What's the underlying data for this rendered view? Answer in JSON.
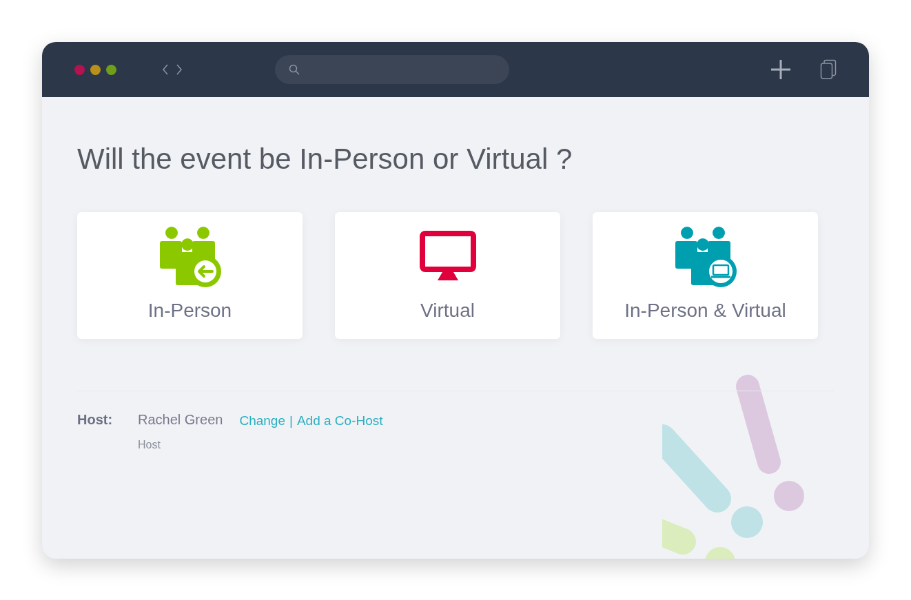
{
  "question": "Will the event be In-Person or Virtual ?",
  "options": [
    {
      "kind": "in-person",
      "label": "In-Person",
      "color": "#8cc800"
    },
    {
      "kind": "virtual",
      "label": "Virtual",
      "color": "#e0003c"
    },
    {
      "kind": "hybrid",
      "label": "In-Person & Virtual",
      "color": "#009fb0"
    }
  ],
  "host": {
    "label": "Host:",
    "name": "Rachel Green",
    "role": "Host",
    "links": [
      "Change",
      "Add a Co-Host"
    ],
    "separator": "|"
  }
}
